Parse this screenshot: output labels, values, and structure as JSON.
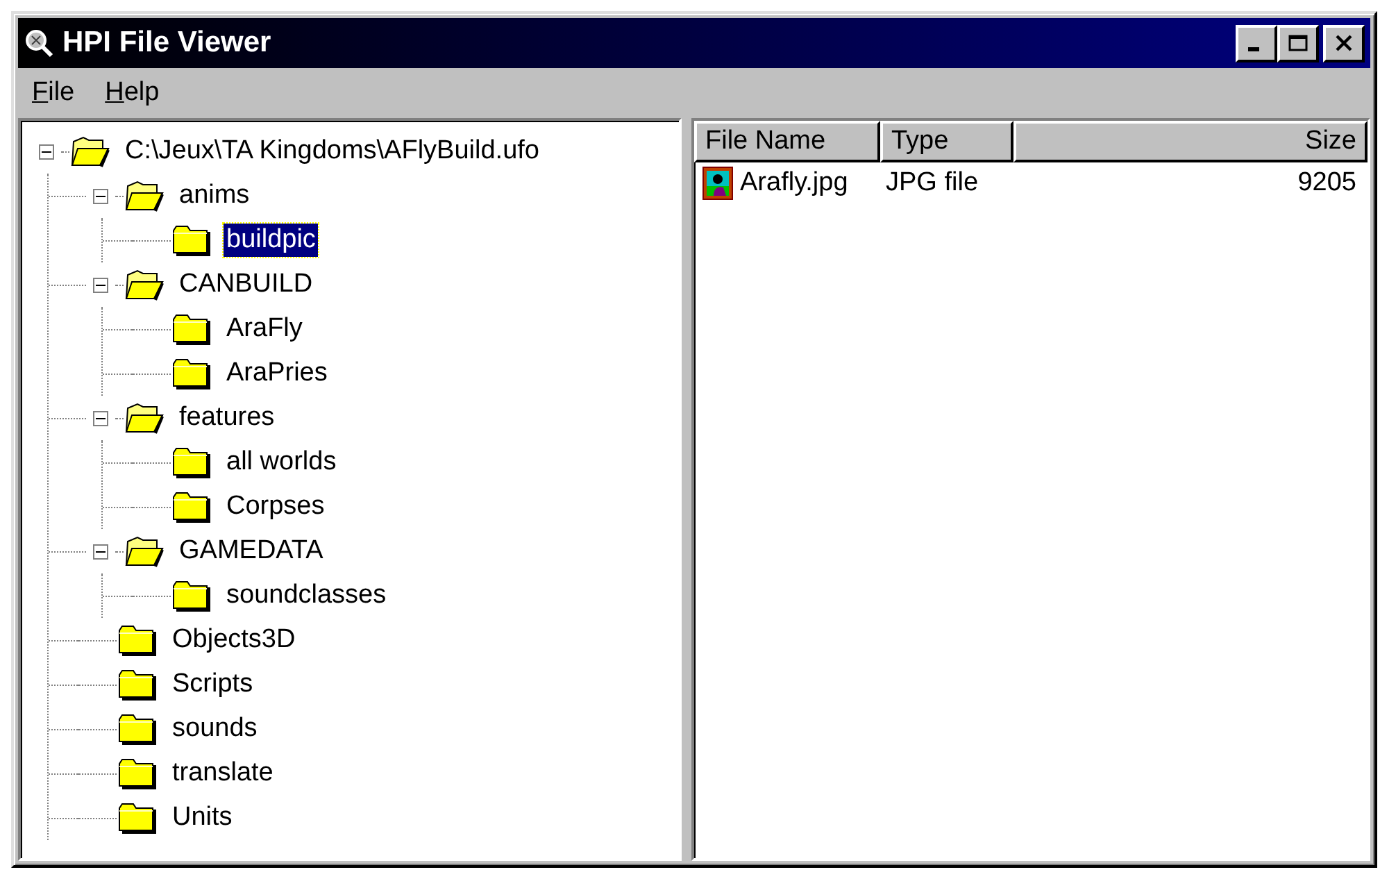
{
  "window": {
    "title": "HPI File Viewer"
  },
  "menu": [
    "File",
    "Help"
  ],
  "tree": [
    {
      "label": "C:\\Jeux\\TA Kingdoms\\AFlyBuild.ufo",
      "expanded": true,
      "selected": false,
      "children": [
        {
          "label": "anims",
          "expanded": true,
          "selected": false,
          "children": [
            {
              "label": "buildpic",
              "selected": true
            }
          ]
        },
        {
          "label": "CANBUILD",
          "expanded": true,
          "selected": false,
          "children": [
            {
              "label": "AraFly",
              "selected": false
            },
            {
              "label": "AraPries",
              "selected": false
            }
          ]
        },
        {
          "label": "features",
          "expanded": true,
          "selected": false,
          "children": [
            {
              "label": "all worlds",
              "selected": false
            },
            {
              "label": "Corpses",
              "selected": false
            }
          ]
        },
        {
          "label": "GAMEDATA",
          "expanded": true,
          "selected": false,
          "children": [
            {
              "label": "soundclasses",
              "selected": false
            }
          ]
        },
        {
          "label": "Objects3D",
          "selected": false
        },
        {
          "label": "Scripts",
          "selected": false
        },
        {
          "label": "sounds",
          "selected": false
        },
        {
          "label": "translate",
          "selected": false
        },
        {
          "label": "Units",
          "selected": false
        }
      ]
    }
  ],
  "file_list": {
    "columns": [
      "File Name",
      "Type",
      "Size"
    ],
    "rows": [
      {
        "name": "Arafly.jpg",
        "type": "JPG file",
        "size": "9205",
        "selected": false
      }
    ]
  }
}
